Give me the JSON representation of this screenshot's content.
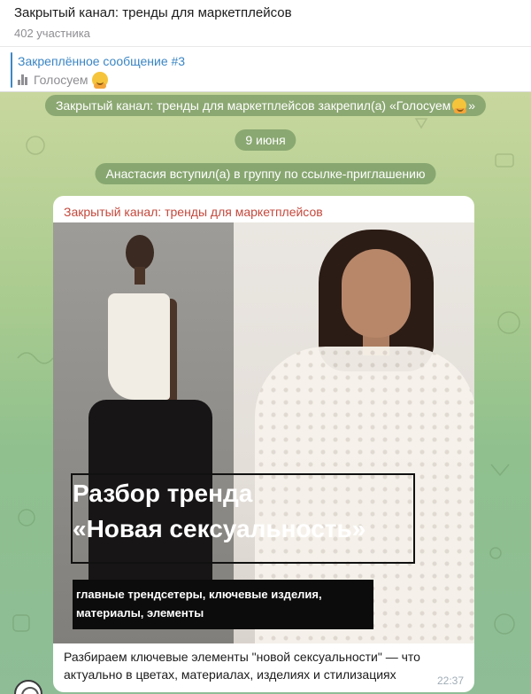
{
  "header": {
    "title": "Закрытый канал: тренды для маркетплейсов",
    "members": "402 участника"
  },
  "pinned": {
    "title": "Закреплённое сообщение #3",
    "text": "Голосуем"
  },
  "service": {
    "pin_notice": "Закрытый канал: тренды для маркетплейсов закрепил(а) «Голосуем",
    "pin_close": "»",
    "date": "9 июня",
    "join_notice": "Анастасия вступил(а) в группу по ссылке-приглашению"
  },
  "message": {
    "sender": "Закрытый канал: тренды для маркетплейсов",
    "image_headline_1": "Разбор тренда",
    "image_headline_2": "«Новая сексуальность»",
    "image_tag": "главные трендсетеры, ключевые изделия, материалы, элементы",
    "caption": "Разбираем ключевые элементы \"новой сексуальности\" — что актуально в цветах, материалах, изделиях и стилизациях",
    "time": "22:37"
  },
  "icons": {
    "poll": "poll-icon",
    "emoji": "hugging-face-emoji-icon",
    "avatar": "channel-avatar-icon"
  },
  "colors": {
    "link_blue": "#3a85c4",
    "sender_red": "#c4483c",
    "service_bg": "#5c8450"
  }
}
